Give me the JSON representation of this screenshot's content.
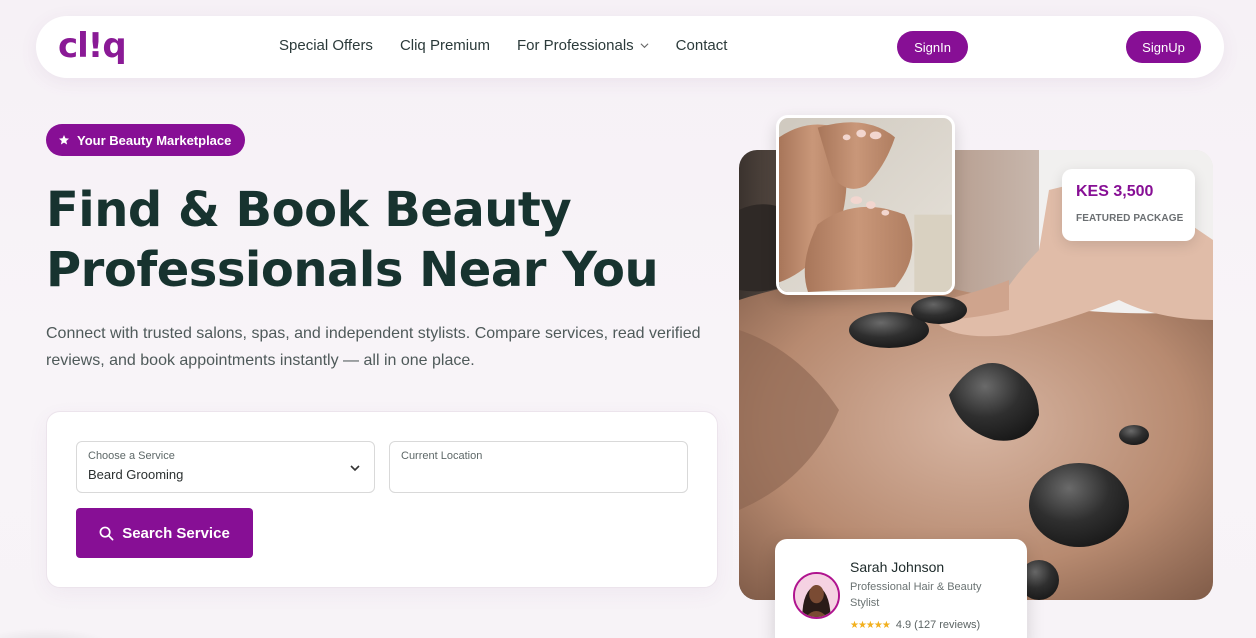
{
  "brand": {
    "logo_text": "cl!q",
    "accent_color": "#870f95"
  },
  "nav": {
    "items": [
      {
        "label": "Special Offers"
      },
      {
        "label": "Cliq Premium"
      },
      {
        "label": "For Professionals",
        "has_dropdown": true
      },
      {
        "label": "Contact"
      }
    ],
    "signin_label": "SignIn",
    "signup_label": "SignUp"
  },
  "hero": {
    "badge": "Your Beauty Marketplace",
    "title_line1": "Find & Book Beauty",
    "title_line2": "Professionals Near You",
    "description": "Connect with trusted salons, spas, and independent stylists. Compare services, read verified reviews, and book appointments instantly — all in one place."
  },
  "search": {
    "service_label": "Choose a Service",
    "service_value": "Beard Grooming",
    "location_label": "Current Location",
    "location_value": "",
    "button_label": "Search Service"
  },
  "featured": {
    "price": "KES 3,500",
    "label": "FEATURED PACKAGE"
  },
  "professional": {
    "name": "Sarah Johnson",
    "title": "Professional Hair & Beauty Stylist",
    "stars": "★★★★★",
    "rating_text": "4.9 (127 reviews)"
  }
}
